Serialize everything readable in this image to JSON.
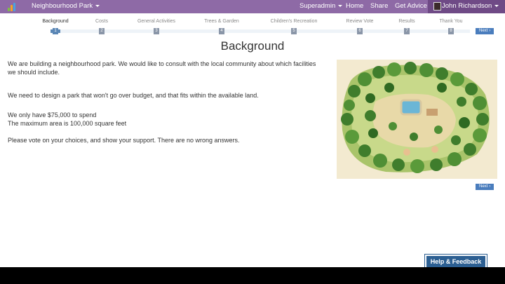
{
  "navbar": {
    "brand": "Neighbourhood Park",
    "items": [
      "Superadmin",
      "Home",
      "Share",
      "Get Advice"
    ],
    "user": "John Richardson",
    "color": "#8e6aa6"
  },
  "steps": [
    {
      "label": "Background",
      "num": "1"
    },
    {
      "label": "Costs",
      "num": "2"
    },
    {
      "label": "General Activities",
      "num": "3"
    },
    {
      "label": "Trees & Garden",
      "num": "4"
    },
    {
      "label": "Children's Recreation",
      "num": "5"
    },
    {
      "label": "Review Vote",
      "num": "6"
    },
    {
      "label": "Results",
      "num": "7"
    },
    {
      "label": "Thank You",
      "num": "8"
    }
  ],
  "next_label": "Next",
  "page": {
    "title": "Background",
    "paragraphs": [
      "We are building a neighbourhood park. We would like to consult with the local community about which facilities we should include.",
      "We need to design a park that won't go over budget, and that fits within the available land.",
      "We only have $75,000 to spend",
      "The maximum area is 100,000 square feet",
      "Please vote on your choices, and show your support. There are no wrong answers."
    ]
  },
  "help_label": "Help & Feedback",
  "accent": "#4a7dbd"
}
